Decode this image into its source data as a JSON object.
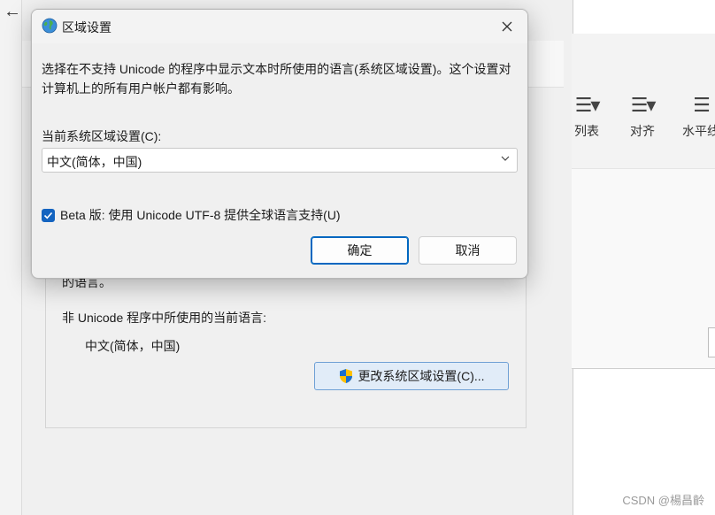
{
  "background": {
    "group_fragment": "的语言。",
    "label": "非 Unicode 程序中所使用的当前语言:",
    "value": "中文(简体，中国)",
    "change_button": "更改系统区域设置(C)...",
    "ribbon": [
      "列表",
      "对齐",
      "水平线"
    ],
    "watermark": "CSDN @楊昌齡"
  },
  "dialog": {
    "title": "区域设置",
    "description": "选择在不支持 Unicode 的程序中显示文本时所使用的语言(系统区域设置)。这个设置对计算机上的所有用户帐户都有影响。",
    "current_label": "当前系统区域设置(C):",
    "current_value": "中文(简体，中国)",
    "beta_checked": true,
    "beta_label": "Beta 版: 使用 Unicode UTF-8 提供全球语言支持(U)",
    "ok_label": "确定",
    "cancel_label": "取消"
  },
  "colors": {
    "accent": "#0067c0",
    "checkbox": "#1464c0"
  }
}
